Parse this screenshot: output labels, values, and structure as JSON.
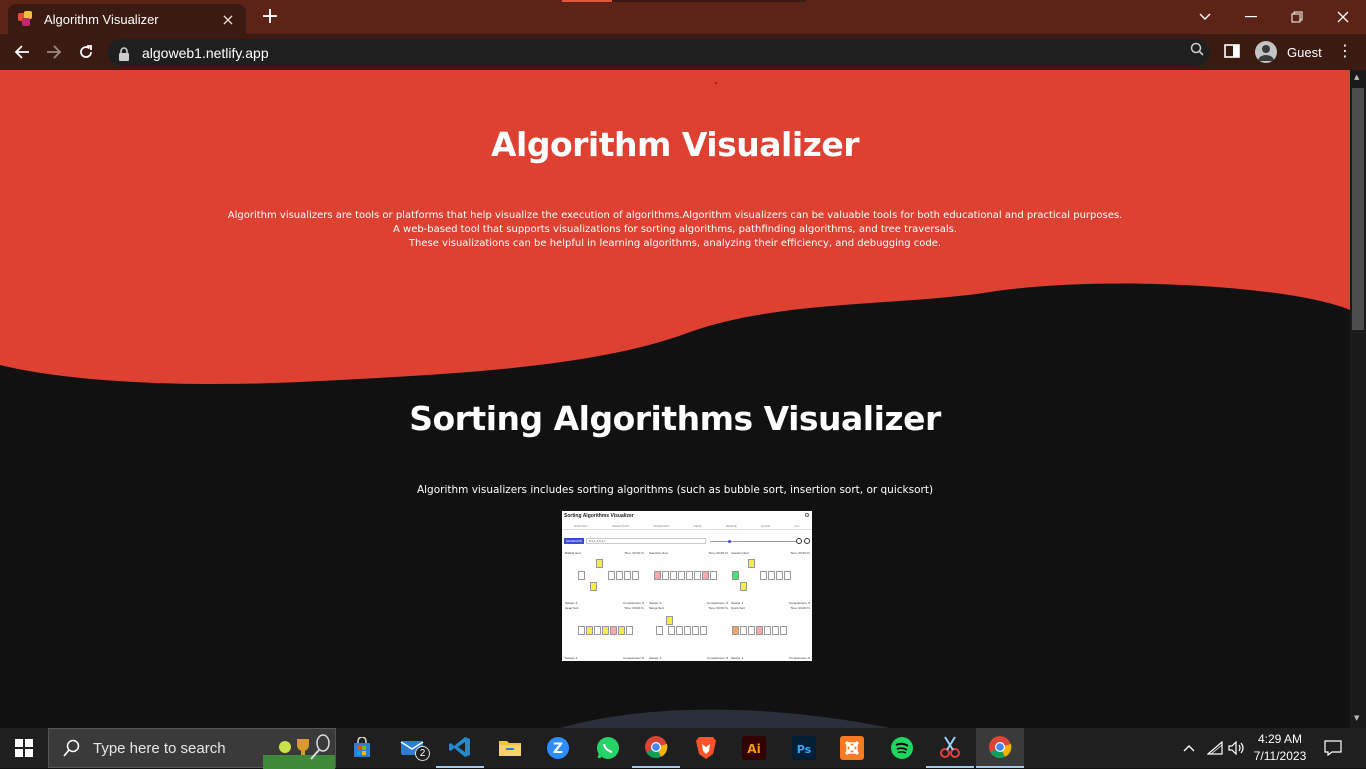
{
  "browser": {
    "tab_title": "Algorithm Visualizer",
    "tab_close": "×",
    "new_tab": "+",
    "url": "algoweb1.netlify.app",
    "profile_name": "Guest",
    "window_controls": {
      "dropdown": "⌄",
      "minimize": "—",
      "restore": "❐",
      "close": "✕"
    },
    "nav": {
      "back": "←",
      "forward": "→",
      "reload": "↻",
      "menu": "⋮"
    },
    "colors": {
      "tab_strip": "#5b2416",
      "toolbar": "#3b1a12",
      "omnibox": "#1f1f1f"
    }
  },
  "hero": {
    "title": "Algorithm Visualizer",
    "description_lines": [
      "Algorithm visualizers are tools or platforms that help visualize the execution of algorithms.Algorithm visualizers can be valuable tools for both educational and practical purposes.",
      "A web-based tool that supports visualizations for sorting algorithms, pathfinding algorithms, and tree traversals.",
      "These visualizations can be helpful in learning algorithms, analyzing their efficiency, and debugging code."
    ],
    "bg_color": "#de4131",
    "dark_color": "#111111"
  },
  "sorting_section": {
    "title": "Sorting Algorithms Visualizer",
    "subtitle": "Algorithm visualizers includes sorting algorithms (such as bubble sort, insertion sort, or quicksort)",
    "preview": {
      "title": "Sorting Algorithms Visualizer",
      "tabs": [
        "SORTING",
        "SELECTION",
        "INSERTION",
        "HEAP",
        "MERGE",
        "QUICK",
        "ALL"
      ],
      "generate_label": "GENERATE",
      "input_value": "8,2,1,4,5,2,7",
      "panels": [
        {
          "name": "Bubble Sort",
          "time": "Time: 00:00:7s",
          "swaps": "Swaps: 6",
          "comparisons": "Comparisons: 8"
        },
        {
          "name": "Selection Sort",
          "time": "Time: 00:00:7s",
          "swaps": "Swaps: 6",
          "comparisons": "Comparisons: 8"
        },
        {
          "name": "Insertion Sort",
          "time": "Time: 00:00:7s",
          "swaps": "Swaps: 4",
          "comparisons": "Comparisons: 8"
        },
        {
          "name": "Heap Sort",
          "time": "Time: 00:00:7s",
          "swaps": "Swaps: 6",
          "comparisons": "Comparisons: 8"
        },
        {
          "name": "Merge Sort",
          "time": "Time: 00:00:7s",
          "swaps": "Swaps: 4",
          "comparisons": "Comparisons: 8"
        },
        {
          "name": "Quick Sort",
          "time": "Time: 00:00:7s",
          "swaps": "Swaps: 3",
          "comparisons": "Comparisons: 8"
        }
      ]
    }
  },
  "taskbar": {
    "search_placeholder": "Type here to search",
    "mail_badge": "2",
    "time": "4:29 AM",
    "date": "7/11/2023",
    "apps": [
      "task-view",
      "microsoft-store",
      "mail",
      "vscode",
      "file-explorer",
      "zoom",
      "whatsapp",
      "chrome",
      "brave",
      "illustrator",
      "photoshop",
      "xampp",
      "spotify",
      "snipping-tool",
      "chrome-active"
    ],
    "labels": {
      "illustrator": "Ai",
      "photoshop": "Ps",
      "zoom": "Z"
    }
  }
}
